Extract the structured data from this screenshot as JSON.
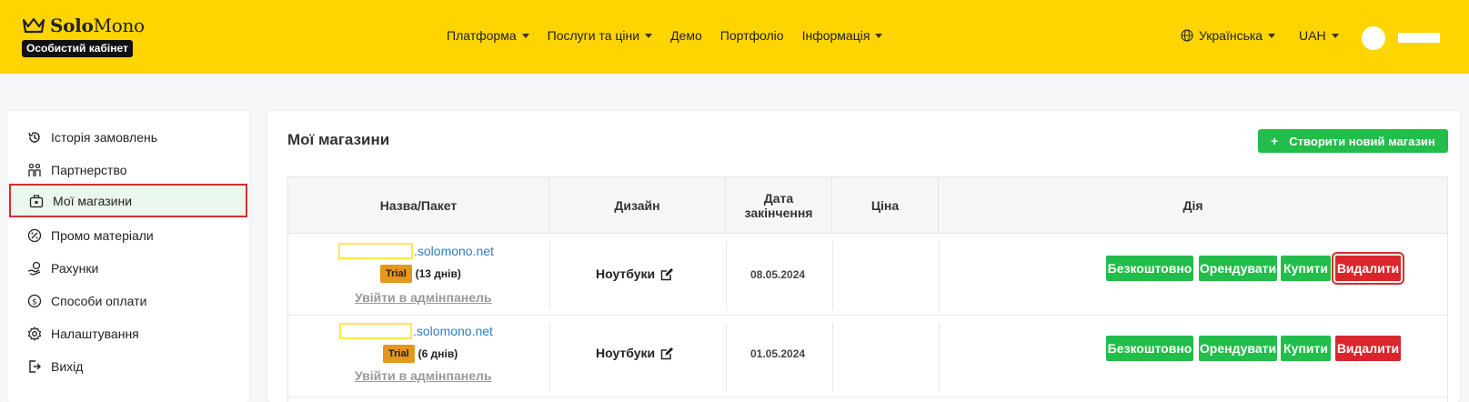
{
  "header": {
    "brand_bold": "Solo",
    "brand_light": "Mono",
    "cabinet_label": "Особистий кабінет",
    "nav": [
      "Платформа",
      "Послуги та ціни",
      "Демо",
      "Портфоліо",
      "Інформація"
    ],
    "language": "Українська",
    "currency": "UAH",
    "accent_color": "#fed500"
  },
  "sidebar": {
    "items": [
      {
        "label": "Історія замовлень",
        "icon": "history-icon"
      },
      {
        "label": "Партнерство",
        "icon": "partners-icon"
      },
      {
        "label": "Мої магазини",
        "icon": "briefcase-icon",
        "active": true
      },
      {
        "label": "Промо матеріали",
        "icon": "percent-icon"
      },
      {
        "label": "Рахунки",
        "icon": "invoice-hand-icon"
      },
      {
        "label": "Способи оплати",
        "icon": "dollar-icon"
      },
      {
        "label": "Налаштування",
        "icon": "gear-icon"
      },
      {
        "label": "Вихід",
        "icon": "logout-icon"
      }
    ]
  },
  "main": {
    "title": "Мої магазини",
    "create_button": "Створити новий магазин",
    "columns": [
      "Назва/Пакет",
      "Дизайн",
      "Дата закінчення",
      "Ціна",
      "Дія"
    ],
    "rows": [
      {
        "domain_suffix": ".solomono.net",
        "badge": "Trial",
        "days": "(13 днів)",
        "admin_link": "Увійти в адмінпанель",
        "design": "Ноутбуки",
        "end_date": "08.05.2024",
        "price": "",
        "actions": [
          "Безкоштовно",
          "Орендувати",
          "Купити",
          "Видалити"
        ]
      },
      {
        "domain_suffix": ".solomono.net",
        "badge": "Trial",
        "days": "(6 днів)",
        "admin_link": "Увійти в адмінпанель",
        "design": "Ноутбуки",
        "end_date": "01.05.2024",
        "price": "",
        "actions": [
          "Безкоштовно",
          "Орендувати",
          "Купити",
          "Видалити"
        ]
      }
    ]
  }
}
